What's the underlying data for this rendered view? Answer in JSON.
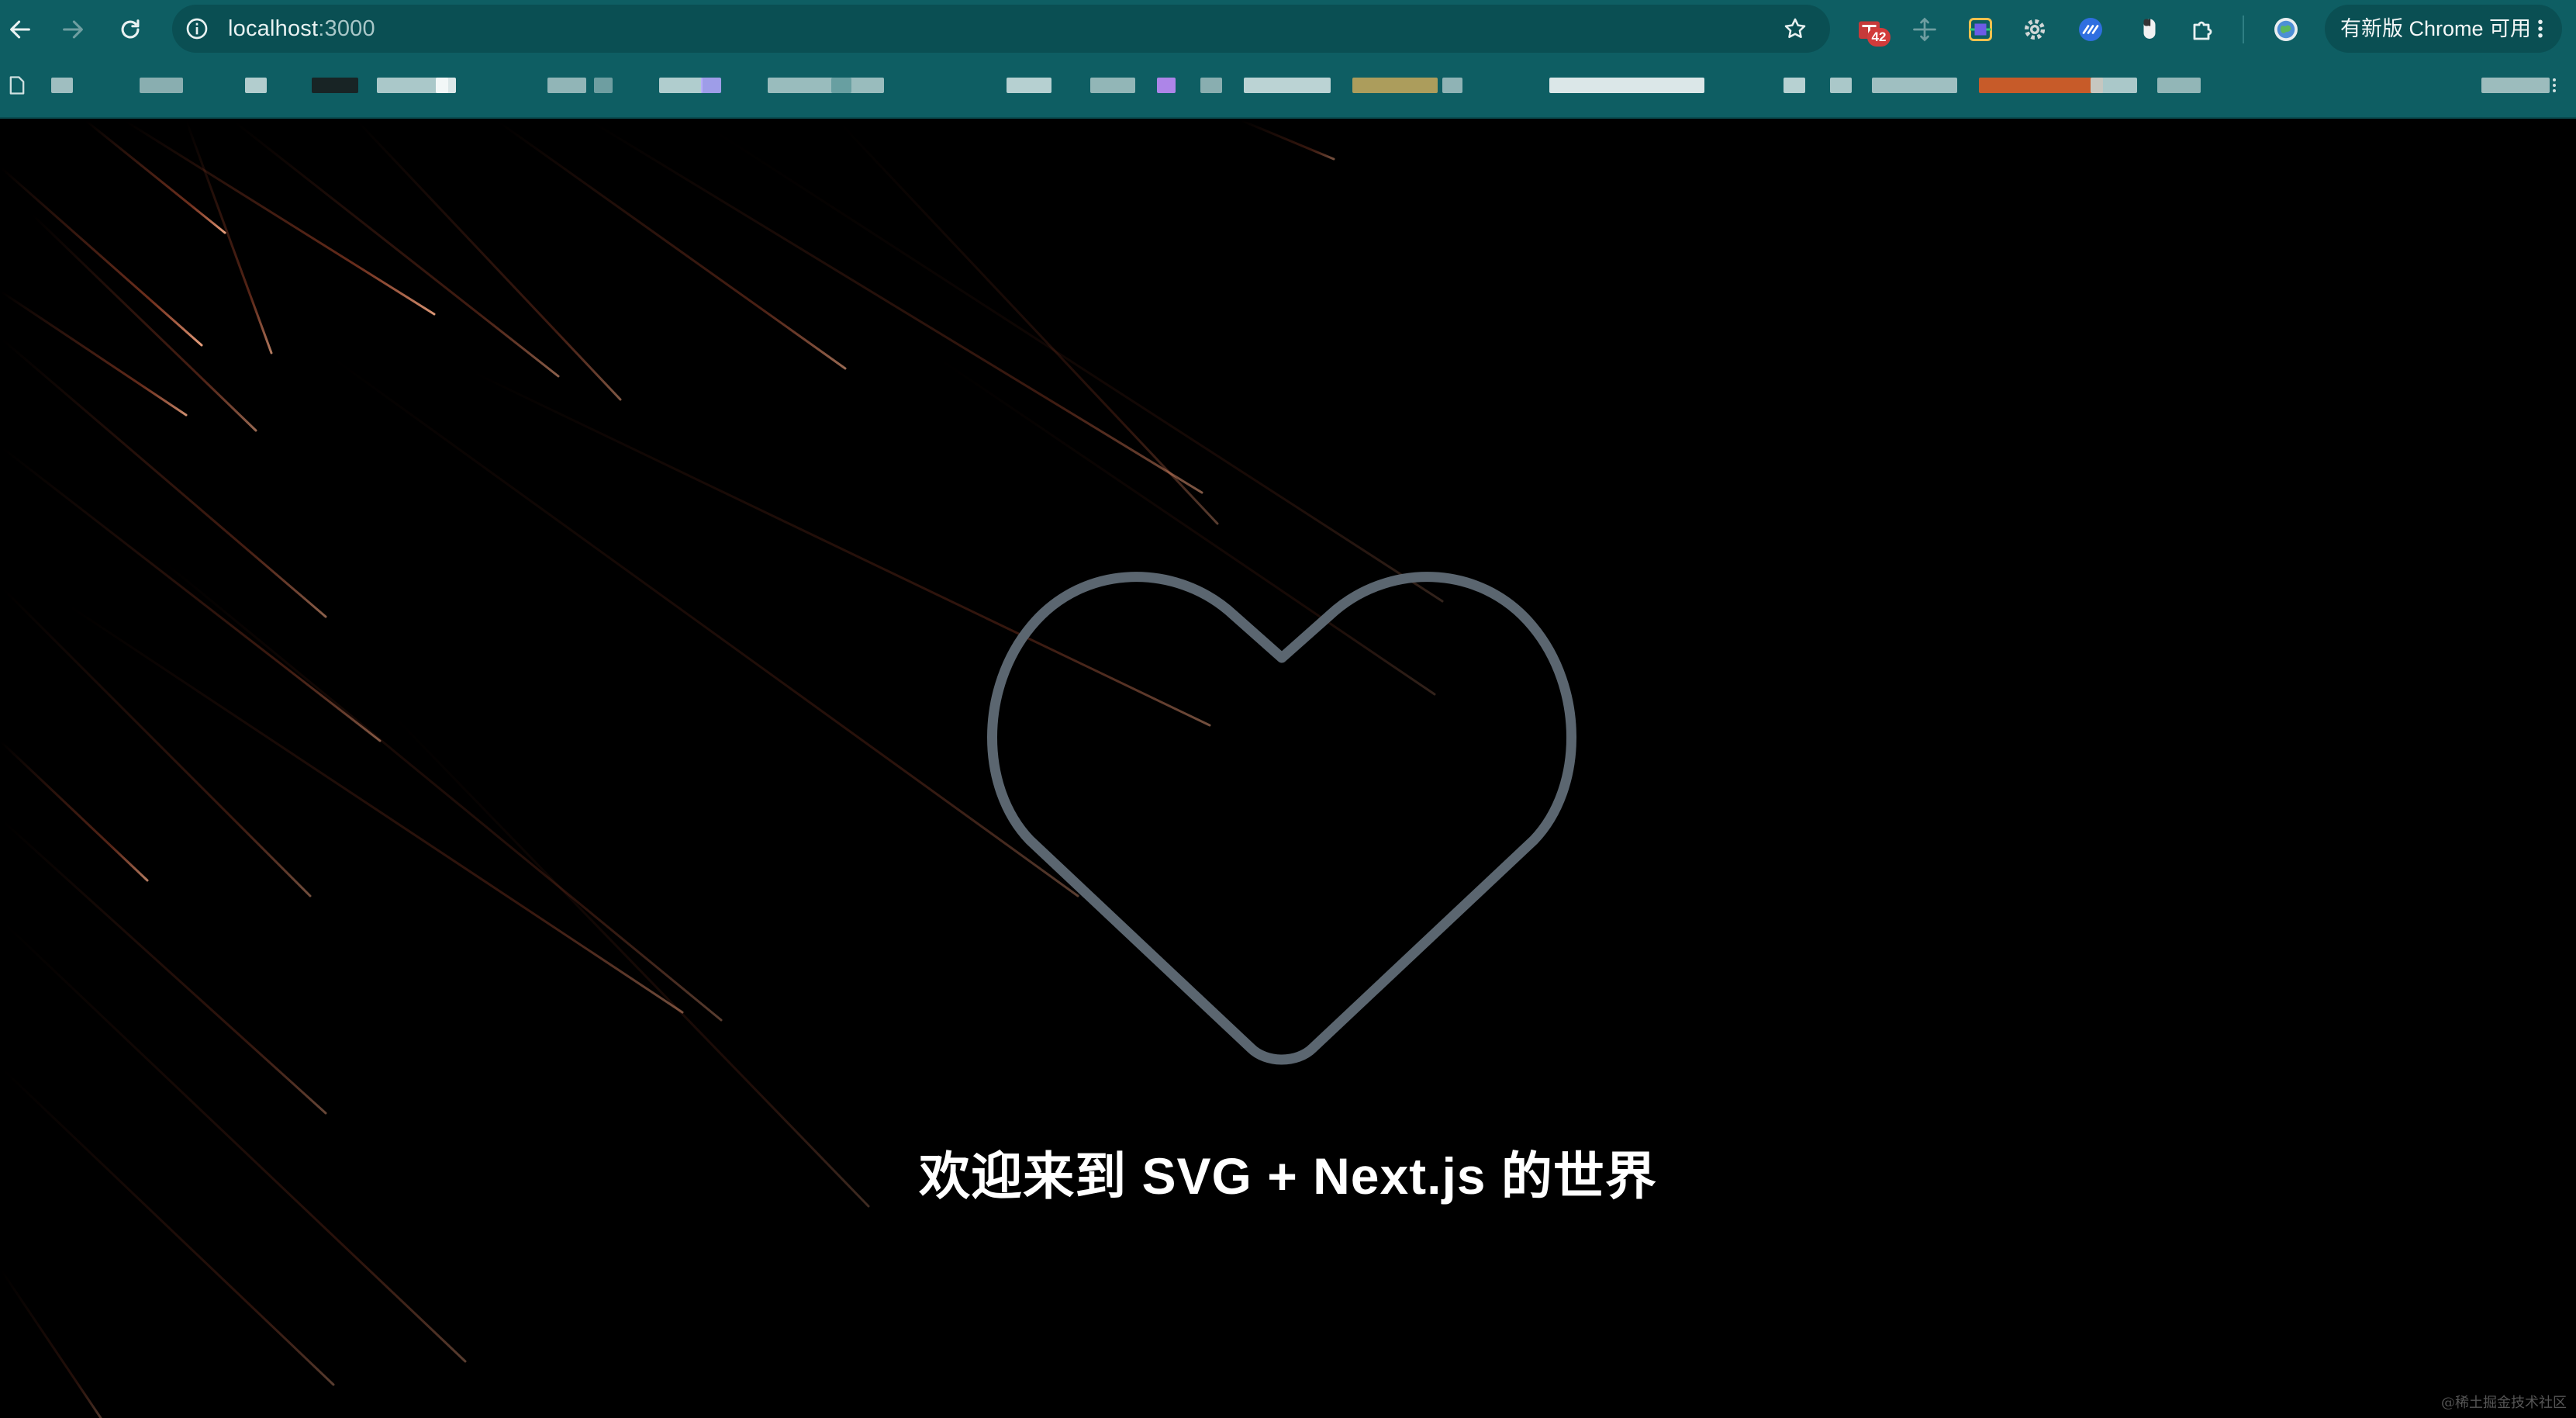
{
  "browser": {
    "url_host": "localhost",
    "url_port": ":3000",
    "update_label": "有新版 Chrome 可用",
    "extension_badge": "42",
    "colors": {
      "chrome_bg": "#0e5e63",
      "omnibox_bg": "#0a4f53"
    },
    "toolbar_icons": [
      "back-icon",
      "forward-icon",
      "reload-icon",
      "site-info-icon",
      "bookmark-star-icon"
    ],
    "extension_icons": [
      "mail-extension-icon",
      "move-extension-icon",
      "screen-capture-extension-icon",
      "settings-extension-icon",
      "speed-extension-icon",
      "mouse-extension-icon",
      "extensions-puzzle-icon",
      "profile-avatar-icon"
    ]
  },
  "page": {
    "headline": "欢迎来到 SVG + Next.js 的世界",
    "watermark": "@稀土掘金技术社区",
    "colors": {
      "background": "#000000",
      "heart_stroke": "#5b6670",
      "streak": "#e0603c",
      "headline": "#ffffff"
    }
  }
}
